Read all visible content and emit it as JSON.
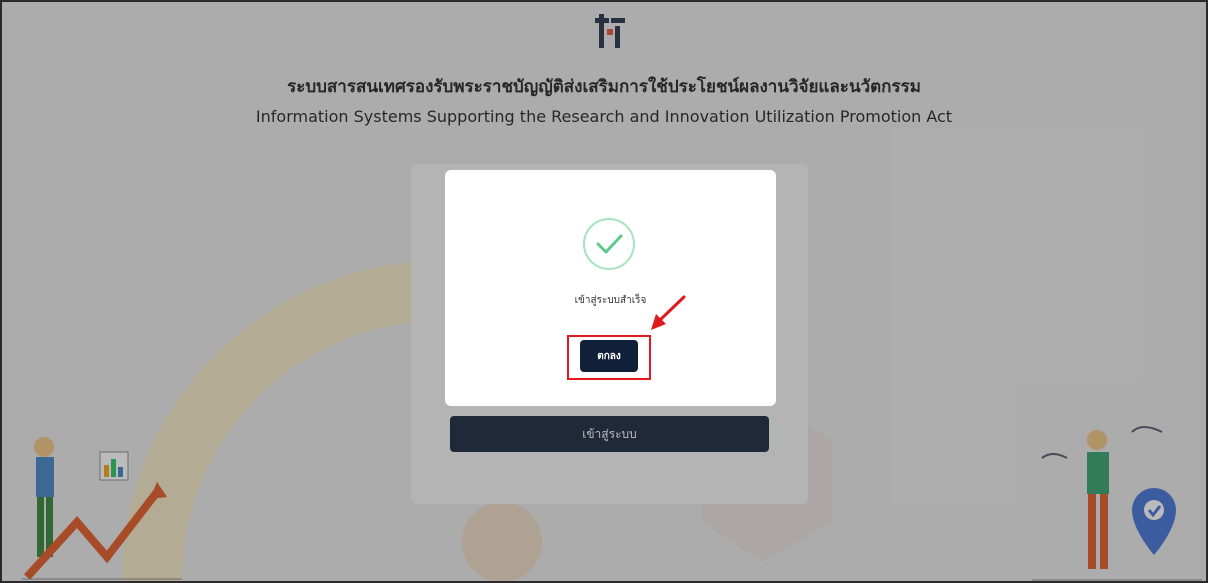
{
  "header": {
    "title_th": "ระบบสารสนเทศรองรับพระราชบัญญัติส่งเสริมการใช้ประโยชน์ผลงานวิจัยและนวัตกรรม",
    "title_en": "Information Systems Supporting the Research and Innovation Utilization Promotion Act"
  },
  "login": {
    "submit_label": "เข้าสู่ระบบ"
  },
  "modal": {
    "message": "เข้าสู่ระบบสำเร็จ",
    "ok_label": "ตกลง",
    "icon": "check-icon"
  },
  "colors": {
    "primary": "#102038",
    "success": "#5cc98a",
    "annotation": "#e0191f"
  }
}
